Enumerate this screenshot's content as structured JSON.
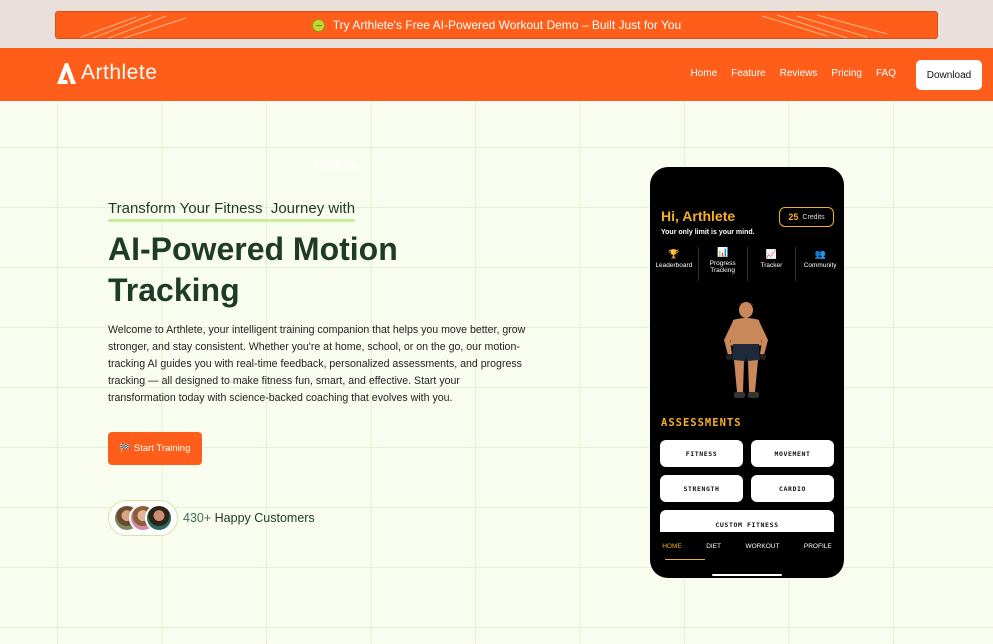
{
  "announcement": {
    "text": "Try Arthlete's Free AI-Powered Workout Demo – Built Just for You",
    "icon": "tennis-ball-icon"
  },
  "brand": {
    "name": "Arthlete",
    "accent": "#ff5e1a"
  },
  "nav": {
    "links": [
      "Home",
      "Feature",
      "Reviews",
      "Pricing",
      "FAQ"
    ],
    "download_label": "Download"
  },
  "ghost_text": "Arthlete",
  "hero": {
    "subheading": "Transform Your Fitness  Journey with",
    "headline": "AI-Powered Motion Tracking",
    "description": "Welcome to Arthlete, your intelligent training companion that helps you move better, grow stronger, and stay consistent. Whether you're at home, school, or on the go, our motion-tracking AI guides you with real-time feedback, personalized assessments, and progress tracking — all designed to make fitness fun, smart, and effective. Start your transformation today with science-backed coaching that evolves with you.",
    "start_icon": "🏁",
    "start_label": "Start Training",
    "customers_count": "430+",
    "customers_label": "Happy Customers"
  },
  "phone": {
    "greeting": "Hi, Arthlete",
    "tagline": "Your only limit is your mind.",
    "credits_value": "25",
    "credits_label": "Credits",
    "menu": [
      {
        "icon": "🏆",
        "label": "Leaderboard"
      },
      {
        "icon": "📊",
        "label": "Progress Tracking"
      },
      {
        "icon": "📈",
        "label": "Tracker"
      },
      {
        "icon": "👥",
        "label": "Community"
      }
    ],
    "assessments_title": "ASSESSMENTS",
    "assessments": [
      "FITNESS",
      "MOVEMENT",
      "STRENGTH",
      "CARDIO",
      "CUSTOM FITNESS"
    ],
    "bottom_nav": [
      "HOME",
      "DIET",
      "WORKOUT",
      "PROFILE"
    ],
    "active_tab": "HOME",
    "accent": "#f4b026"
  }
}
